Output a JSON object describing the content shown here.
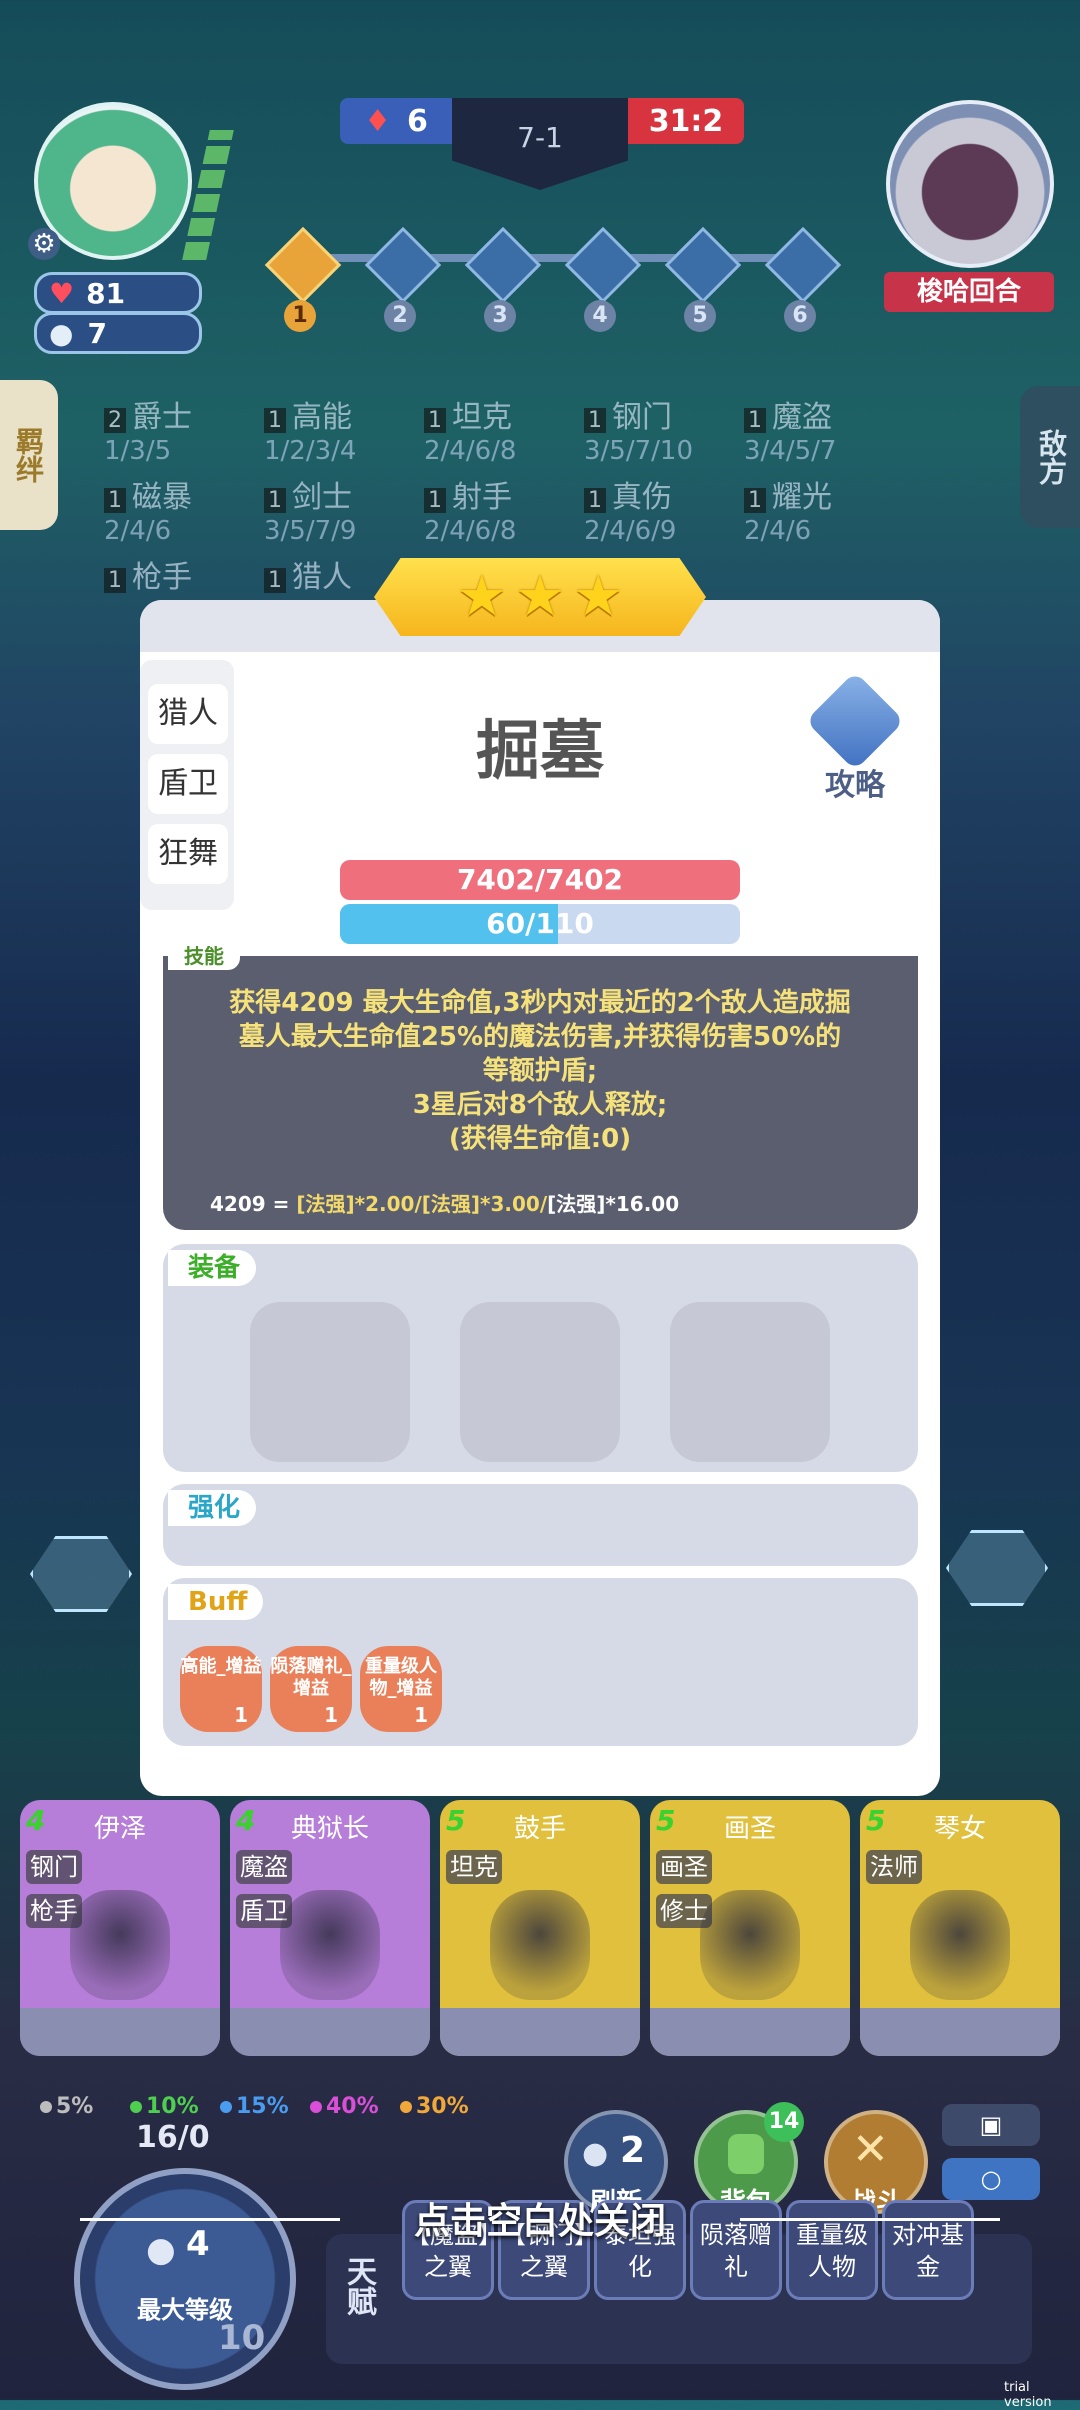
{
  "top": {
    "left_score": "6",
    "round": "7-1",
    "right_score": "31:2",
    "opponent_name": "梭哈回合"
  },
  "player": {
    "hp": "81",
    "gold": "7"
  },
  "stages": [
    "1",
    "2",
    "3",
    "4",
    "5",
    "6"
  ],
  "side_tabs": {
    "left": "羁绊",
    "right": "敌方"
  },
  "synergies": [
    {
      "count": "2",
      "name": "爵士",
      "levels": "1/3/5"
    },
    {
      "count": "1",
      "name": "高能",
      "levels": "1/2/3/4"
    },
    {
      "count": "1",
      "name": "坦克",
      "levels": "2/4/6/8"
    },
    {
      "count": "1",
      "name": "钢门",
      "levels": "3/5/7/10"
    },
    {
      "count": "1",
      "name": "魔盗",
      "levels": "3/4/5/7"
    },
    {
      "count": "1",
      "name": "磁暴",
      "levels": "2/4/6"
    },
    {
      "count": "1",
      "name": "剑士",
      "levels": "3/5/7/9"
    },
    {
      "count": "1",
      "name": "射手",
      "levels": "2/4/6/8"
    },
    {
      "count": "1",
      "name": "真伤",
      "levels": "2/4/6/9"
    },
    {
      "count": "1",
      "name": "耀光",
      "levels": "2/4/6"
    },
    {
      "count": "1",
      "name": "枪手",
      "levels": ""
    },
    {
      "count": "1",
      "name": "猎人",
      "levels": ""
    }
  ],
  "hero": {
    "name": "掘墓",
    "tags": [
      "猎人",
      "盾卫",
      "狂舞"
    ],
    "guide_label": "攻略",
    "hp_text": "7402/7402",
    "hp_fraction": 1.0,
    "mana_text": "60/110",
    "mana_fraction": 0.545,
    "skill_label": "技能",
    "skill_lines": [
      "获得4209 最大生命值,3秒内对最近的2个敌人造成掘",
      "墓人最大生命值25%的魔法伤害,并获得伤害50%的",
      "等额护盾;",
      "3星后对8个敌人释放;",
      "(获得生命值:0)"
    ],
    "formula_a": "4209 = ",
    "formula_b": "[法强]*2.00/[法强]*3.00/",
    "formula_c": "[法强]*16.00",
    "equip_label": "装备",
    "enhance_label": "强化",
    "buff_label": "Buff",
    "buffs": [
      {
        "name": "高能_增益",
        "count": "1"
      },
      {
        "name": "陨落赠礼_增益",
        "count": "1"
      },
      {
        "name": "重量级人物_增益",
        "count": "1"
      }
    ]
  },
  "shop": [
    {
      "cost": "4",
      "name": "伊泽",
      "tags": [
        "钢门",
        "枪手"
      ],
      "color": "#b67ed8"
    },
    {
      "cost": "4",
      "name": "典狱长",
      "tags": [
        "魔盗",
        "盾卫"
      ],
      "color": "#b67ed8"
    },
    {
      "cost": "5",
      "name": "鼓手",
      "tags": [
        "坦克"
      ],
      "color": "#e0c03c"
    },
    {
      "cost": "5",
      "name": "画圣",
      "tags": [
        "画圣",
        "修士"
      ],
      "color": "#e0c03c"
    },
    {
      "cost": "5",
      "name": "琴女",
      "tags": [
        "法师"
      ],
      "color": "#e0c03c"
    }
  ],
  "odds": [
    {
      "value": "5%",
      "color": "#bdbdbd"
    },
    {
      "value": "10%",
      "color": "#4fcf4f"
    },
    {
      "value": "15%",
      "color": "#4a9cf0"
    },
    {
      "value": "40%",
      "color": "#d94fd8"
    },
    {
      "value": "30%",
      "color": "#f0a83a"
    }
  ],
  "bottom": {
    "xp": "16/0",
    "level_gold": "4",
    "level_label": "最大等级",
    "level": "10",
    "refresh_label": "刷新",
    "refresh_cost": "2",
    "bag_label": "背包",
    "bag_count": "14",
    "fight_label": "战斗",
    "talent_label": "天赋",
    "close_hint": "点击空白处关闭",
    "trial": "trial version"
  },
  "talents": [
    "【魔盗】之翼",
    "【钢门】之翼",
    "泰坦强化",
    "陨落赠礼",
    "重量级人物",
    "对冲基金"
  ]
}
